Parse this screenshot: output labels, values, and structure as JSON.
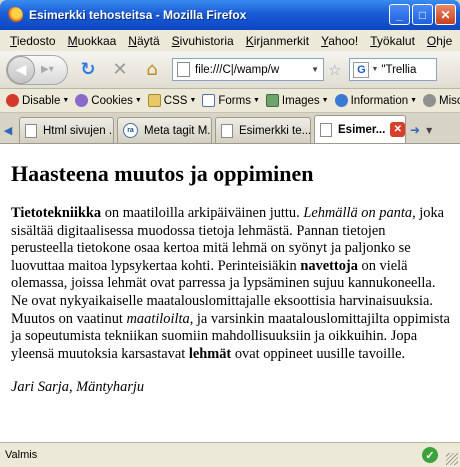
{
  "window": {
    "title": "Esimerkki tehosteitsa - Mozilla Firefox"
  },
  "menu": [
    "Tiedosto",
    "Muokkaa",
    "Näytä",
    "Sivuhistoria",
    "Kirjanmerkit",
    "Yahoo!",
    "Työkalut",
    "Ohje"
  ],
  "nav": {
    "url": "file:///C|/wamp/w",
    "search_value": "\"Trellia"
  },
  "devbar": [
    "Disable",
    "Cookies",
    "CSS",
    "Forms",
    "Images",
    "Information",
    "Miscell"
  ],
  "tabs": [
    {
      "label": "Html sivujen ..."
    },
    {
      "label": "Meta tagit M..."
    },
    {
      "label": "Esimerkki te..."
    },
    {
      "label": "Esimer..."
    }
  ],
  "page": {
    "heading": "Haasteena muutos ja oppiminen",
    "p1_bold": "Tietotekniikka",
    "p1_a": " on maatiloilla arkipäiväinen juttu. ",
    "p1_italic": "Lehmällä on panta",
    "p1_b": ", joka sisältää digitaalisessa muodossa tietoja lehmästä. Pannan tietojen perusteella tietokone osaa kertoa mitä lehmä on syönyt ja paljonko se luovuttaa maitoa lypsykertaa kohti. Perinteisiäkin ",
    "p1_bold2": "navettoja",
    "p1_c": " on vielä olemassa, joissa lehmät ovat parressa ja lypsäminen sujuu kannukoneella. Ne ovat nykyaikaiselle maatalouslomittajalle eksoottisia harvinaisuuksia. Muutos on vaatinut ",
    "p1_italic2": "maatiloilta",
    "p1_d": ", ja varsinkin maatalouslomittajilta oppimista ja sopeutumista tekniikan suomiin mahdollisuuksiin ja oikkuihin. Jopa yleensä muutoksia karsastavat ",
    "p1_bold3": "lehmät",
    "p1_e": " ovat oppineet uusille tavoille.",
    "signature": "Jari Sarja, Mäntyharju"
  },
  "status": {
    "text": "Valmis"
  }
}
